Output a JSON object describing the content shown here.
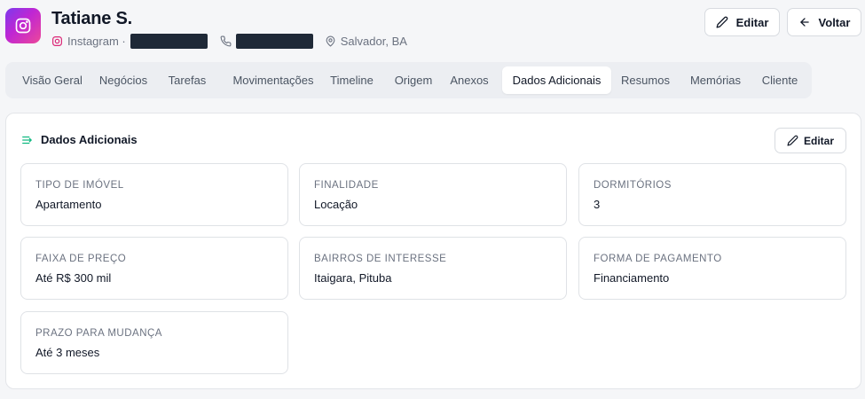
{
  "contact": {
    "name": "Tatiane S.",
    "source": "Instagram ·",
    "location": "Salvador, BA"
  },
  "header": {
    "edit_label": "Editar",
    "back_label": "Voltar"
  },
  "tabs": [
    {
      "label": "Visão Geral",
      "active": false
    },
    {
      "label": "Negócios",
      "active": false
    },
    {
      "label": "Tarefas",
      "active": false
    },
    {
      "label": "Movimentações",
      "active": false
    },
    {
      "label": "Timeline",
      "active": false
    },
    {
      "label": "Origem",
      "active": false
    },
    {
      "label": "Anexos",
      "active": false
    },
    {
      "label": "Dados Adicionais",
      "active": true
    },
    {
      "label": "Resumos",
      "active": false
    },
    {
      "label": "Memórias",
      "active": false
    },
    {
      "label": "Cliente",
      "active": false
    }
  ],
  "panel": {
    "title": "Dados Adicionais",
    "edit_label": "Editar",
    "fields": [
      {
        "label": "Tipo de Imóvel",
        "value": "Apartamento"
      },
      {
        "label": "Finalidade",
        "value": "Locação"
      },
      {
        "label": "Dormitórios",
        "value": "3"
      },
      {
        "label": "Faixa de Preço",
        "value": "Até R$ 300 mil"
      },
      {
        "label": "Bairros de Interesse",
        "value": "Itaigara, Pituba"
      },
      {
        "label": "Forma de Pagamento",
        "value": "Financiamento"
      },
      {
        "label": "Prazo para Mudança",
        "value": "Até 3 meses"
      }
    ]
  },
  "colors": {
    "accent_green": "#10b981",
    "avatar_gradient": [
      "#7c3aed",
      "#c026d3",
      "#ec4899"
    ],
    "redaction": "#1f2937"
  },
  "icons": {
    "avatar": "instagram-icon",
    "source": "instagram-icon",
    "phone": "phone-icon",
    "location": "map-pin-icon",
    "edit": "pencil-icon",
    "back": "arrow-left-icon",
    "panel": "list-arrow-icon"
  }
}
